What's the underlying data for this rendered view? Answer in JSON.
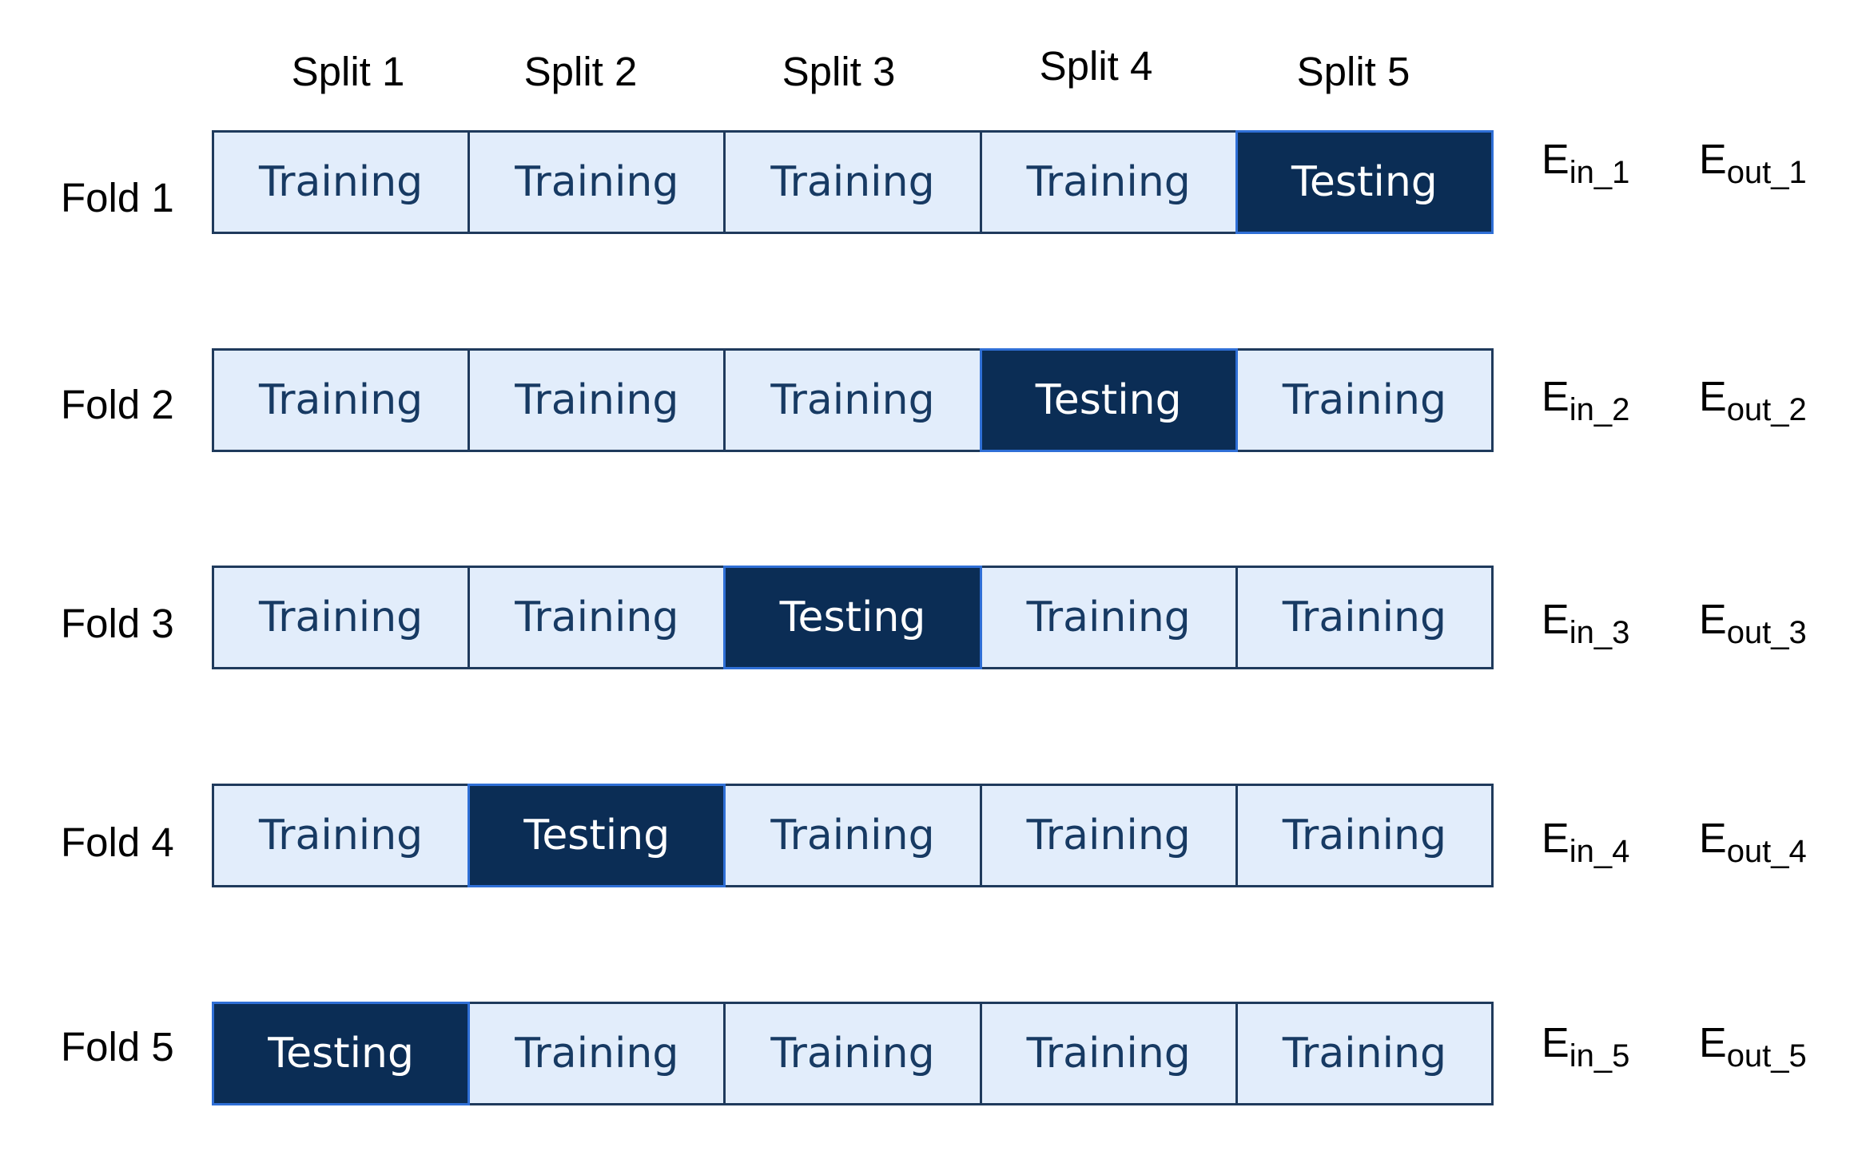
{
  "splits": [
    "Split 1",
    "Split 2",
    "Split 3",
    "Split 4",
    "Split 5"
  ],
  "folds": [
    {
      "label": "Fold 1",
      "cells": [
        "Training",
        "Training",
        "Training",
        "Training",
        "Testing"
      ],
      "ein_base": "E",
      "ein_sub": "in_1",
      "eout_base": "E",
      "eout_sub": "out_1"
    },
    {
      "label": "Fold 2",
      "cells": [
        "Training",
        "Training",
        "Training",
        "Testing",
        "Training"
      ],
      "ein_base": "E",
      "ein_sub": "in_2",
      "eout_base": "E",
      "eout_sub": "out_2"
    },
    {
      "label": "Fold 3",
      "cells": [
        "Training",
        "Training",
        "Testing",
        "Training",
        "Training"
      ],
      "ein_base": "E",
      "ein_sub": "in_3",
      "eout_base": "E",
      "eout_sub": "out_3"
    },
    {
      "label": "Fold 4",
      "cells": [
        "Training",
        "Testing",
        "Training",
        "Training",
        "Training"
      ],
      "ein_base": "E",
      "ein_sub": "in_4",
      "eout_base": "E",
      "eout_sub": "out_4"
    },
    {
      "label": "Fold 5",
      "cells": [
        "Testing",
        "Training",
        "Training",
        "Training",
        "Training"
      ],
      "ein_base": "E",
      "ein_sub": "in_5",
      "eout_base": "E",
      "eout_sub": "out_5"
    }
  ],
  "colors": {
    "training_fill": "#e2edfb",
    "training_text": "#173a63",
    "testing_fill": "#0b2d55",
    "testing_text": "#ffffff",
    "border": "#1f3a5c"
  }
}
